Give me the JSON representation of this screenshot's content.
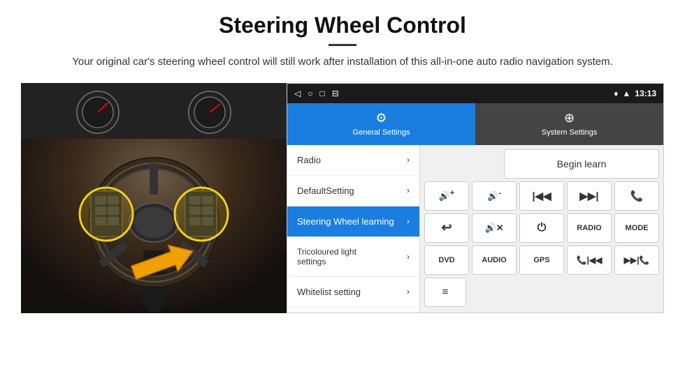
{
  "header": {
    "title": "Steering Wheel Control",
    "divider": true,
    "subtitle": "Your original car's steering wheel control will still work after installation of this all-in-one auto radio navigation system."
  },
  "statusBar": {
    "icons": [
      "◁",
      "○",
      "□",
      "⊟"
    ],
    "rightIcons": "♦ ▲",
    "time": "13:13"
  },
  "tabs": [
    {
      "label": "General Settings",
      "icon": "⚙",
      "active": true
    },
    {
      "label": "System Settings",
      "icon": "🌐",
      "active": false
    }
  ],
  "menu": {
    "items": [
      {
        "label": "Radio",
        "active": false
      },
      {
        "label": "DefaultSetting",
        "active": false
      },
      {
        "label": "Steering Wheel learning",
        "active": true
      },
      {
        "label": "Tricoloured light settings",
        "active": false
      },
      {
        "label": "Whitelist setting",
        "active": false
      }
    ]
  },
  "controls": {
    "beginLearn": "Begin learn",
    "row1": [
      {
        "icon": "🔊+",
        "label": "vol+"
      },
      {
        "icon": "🔊-",
        "label": "vol-"
      },
      {
        "icon": "|◀◀",
        "label": "prev"
      },
      {
        "icon": "▶▶|",
        "label": "next"
      },
      {
        "icon": "📞",
        "label": "call"
      }
    ],
    "row2": [
      {
        "icon": "↩",
        "label": "back"
      },
      {
        "icon": "🔇✕",
        "label": "mute"
      },
      {
        "icon": "⏻",
        "label": "power"
      },
      {
        "label": "RADIO",
        "text": true
      },
      {
        "label": "MODE",
        "text": true
      }
    ],
    "row3": [
      {
        "label": "DVD",
        "text": true
      },
      {
        "label": "AUDIO",
        "text": true
      },
      {
        "label": "GPS",
        "text": true
      },
      {
        "icon": "📞◀◀",
        "label": "tel-prev"
      },
      {
        "icon": "▶▶📞",
        "label": "tel-next"
      }
    ],
    "row4": [
      {
        "icon": "≡",
        "label": "menu-icon"
      }
    ]
  }
}
